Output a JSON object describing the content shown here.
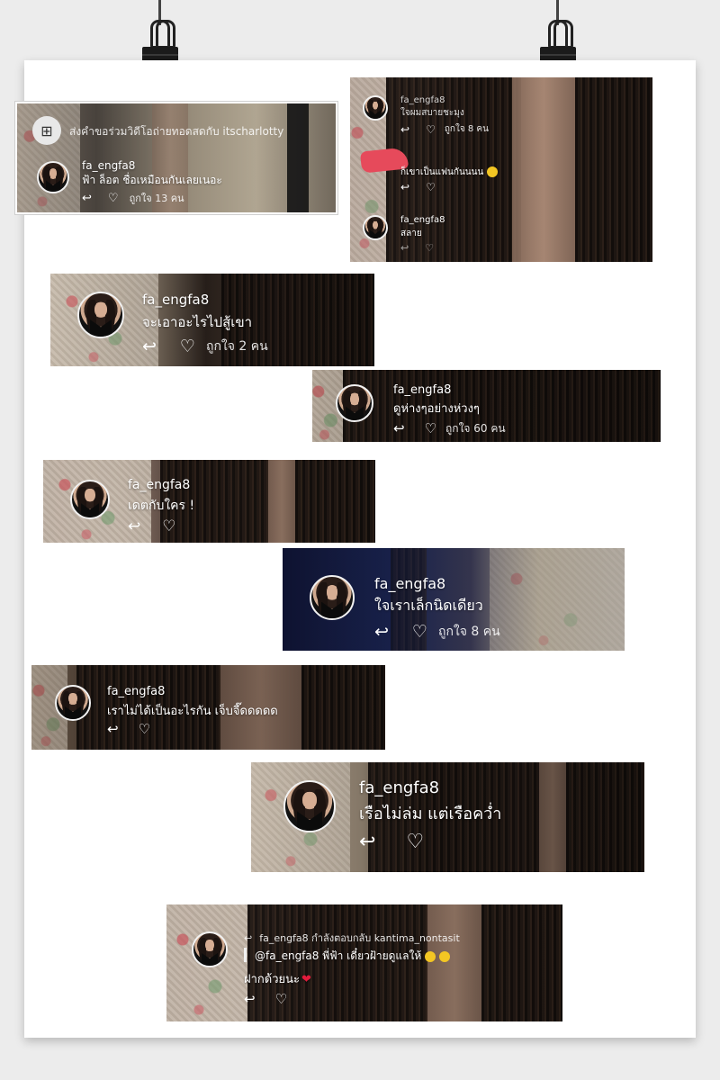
{
  "invite": {
    "text": "ส่งคำขอร่วมวิดีโอถ่ายทอดสดกับ itscharlotty",
    "icon": "video-add-icon"
  },
  "comments": [
    {
      "user": "fa_engfa8",
      "text": "ฟ้า ล็อต ชื่อเหมือนกันเลยเนอะ",
      "likes": "ถูกใจ 13 คน"
    },
    {
      "user": "fa_engfa8",
      "text": "ใจผมสบายชะมุง",
      "likes": "ถูกใจ 8 คน"
    },
    {
      "user": "",
      "text": "ก็เขาเป็นแฟนกันนนน"
    },
    {
      "user": "fa_engfa8",
      "text": "สลาย"
    },
    {
      "user": "fa_engfa8",
      "text": "จะเอาอะไรไปสู้เขา",
      "likes": "ถูกใจ 2 คน"
    },
    {
      "user": "fa_engfa8",
      "text": "ดูห่างๆอย่างห่วงๆ",
      "likes": "ถูกใจ 60 คน"
    },
    {
      "user": "fa_engfa8",
      "text": "เดตกับใคร !"
    },
    {
      "user": "fa_engfa8",
      "text": "ใจเราเล็กนิดเดียว",
      "likes": "ถูกใจ 8 คน"
    },
    {
      "user": "fa_engfa8",
      "text": "เราไม่ได้เป็นอะไรกัน เจ็บจี๊ดดดดด"
    },
    {
      "user": "fa_engfa8",
      "text": "เรือไม่ล่ม แต่เรือคว่ำ"
    }
  ],
  "last_reply": {
    "header": "fa_engfa8 กำลังตอบกลับ kantima_nontasit",
    "quote": "@fa_engfa8 พี่ฟ้า เดี๋ยวฝ้ายดูแลให้",
    "text": "ฝากด้วยนะ"
  },
  "icons": {
    "reply": "reply-arrow-icon",
    "like": "heart-outline-icon",
    "avatar": "profile-avatar",
    "heart_emoji": "red-heart-emoji"
  },
  "colors": {
    "background": "#ececec",
    "poster": "#ffffff",
    "text": "#ffffff",
    "heart": "#e21b3c",
    "redaction": "#e64a5b"
  }
}
